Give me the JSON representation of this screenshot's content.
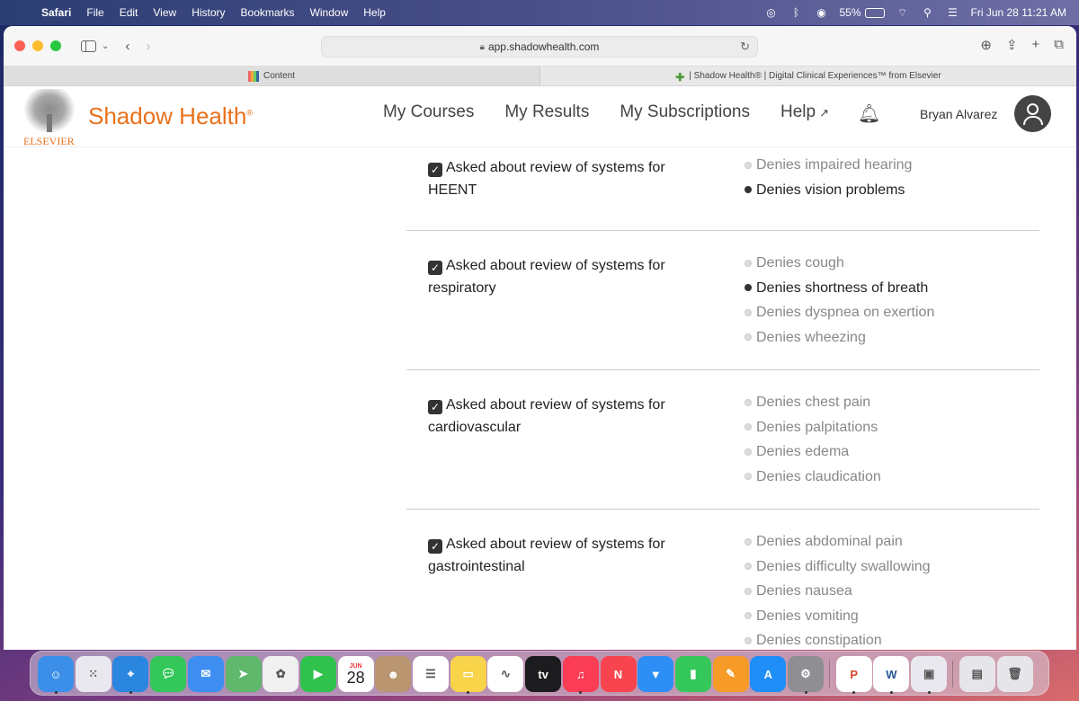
{
  "menubar": {
    "app": "Safari",
    "items": [
      "File",
      "Edit",
      "View",
      "History",
      "Bookmarks",
      "Window",
      "Help"
    ],
    "battery": "55%",
    "battery_level": 0.55,
    "datetime": "Fri Jun 28  11:21 AM"
  },
  "browser": {
    "url": "app.shadowhealth.com",
    "tabs": [
      {
        "label": "Content",
        "active": true
      },
      {
        "label": "| Shadow Health® | Digital Clinical Experiences™ from Elsevier",
        "active": false
      }
    ]
  },
  "site": {
    "publisher": "ELSEVIER",
    "brand": "Shadow Health",
    "brand_mark": "®",
    "nav": [
      "My Courses",
      "My Results",
      "My Subscriptions",
      "Help"
    ],
    "help_ext_icon": "external-link-icon",
    "user": "Bryan Alvarez",
    "colors": {
      "brand": "#e9711c",
      "text": "#444444"
    }
  },
  "review": [
    {
      "question": "Asked about review of systems for HEENT",
      "checked": true,
      "findings": [
        {
          "text": "Denies impaired hearing",
          "selected": false
        },
        {
          "text": "Denies vision problems",
          "selected": true
        }
      ]
    },
    {
      "question": "Asked about review of systems for respiratory",
      "checked": true,
      "findings": [
        {
          "text": "Denies cough",
          "selected": false
        },
        {
          "text": "Denies shortness of breath",
          "selected": true
        },
        {
          "text": "Denies dyspnea on exertion",
          "selected": false
        },
        {
          "text": "Denies wheezing",
          "selected": false
        }
      ]
    },
    {
      "question": "Asked about review of systems for cardiovascular",
      "checked": true,
      "findings": [
        {
          "text": "Denies chest pain",
          "selected": false
        },
        {
          "text": "Denies palpitations",
          "selected": false
        },
        {
          "text": "Denies edema",
          "selected": false
        },
        {
          "text": "Denies claudication",
          "selected": false
        }
      ]
    },
    {
      "question": "Asked about review of systems for gastrointestinal",
      "checked": true,
      "findings": [
        {
          "text": "Denies abdominal pain",
          "selected": false
        },
        {
          "text": "Denies difficulty swallowing",
          "selected": false
        },
        {
          "text": "Denies nausea",
          "selected": false
        },
        {
          "text": "Denies vomiting",
          "selected": false
        },
        {
          "text": "Denies constipation",
          "selected": false
        }
      ]
    }
  ],
  "dock": {
    "calendar_month": "JUN",
    "calendar_day": "28",
    "tv_label": "tv",
    "apps": [
      {
        "name": "finder-icon",
        "color": "#3b8fe8",
        "running": true
      },
      {
        "name": "launchpad-icon",
        "color": "#e8e8ee",
        "running": false
      },
      {
        "name": "safari-icon",
        "color": "#2b86e0",
        "running": true
      },
      {
        "name": "messages-icon",
        "color": "#34c759",
        "running": false
      },
      {
        "name": "mail-icon",
        "color": "#3d8ef0",
        "running": false
      },
      {
        "name": "maps-icon",
        "color": "#5fb86b",
        "running": false
      },
      {
        "name": "photos-icon",
        "color": "#f0f0f0",
        "running": false
      },
      {
        "name": "facetime-icon",
        "color": "#2fc24c",
        "running": false
      },
      {
        "name": "calendar-icon",
        "color": "#ffffff",
        "running": false
      },
      {
        "name": "contacts-icon",
        "color": "#b99570",
        "running": false
      },
      {
        "name": "reminders-icon",
        "color": "#ffffff",
        "running": false
      },
      {
        "name": "notes-icon",
        "color": "#f7d44a",
        "running": true
      },
      {
        "name": "freeform-icon",
        "color": "#ffffff",
        "running": false
      },
      {
        "name": "tv-icon",
        "color": "#1c1c1e",
        "running": false
      },
      {
        "name": "music-icon",
        "color": "#fa3c55",
        "running": true
      },
      {
        "name": "news-icon",
        "color": "#f7444e",
        "running": false
      },
      {
        "name": "keynote-icon",
        "color": "#2d8ef5",
        "running": false
      },
      {
        "name": "numbers-icon",
        "color": "#34c759",
        "running": false
      },
      {
        "name": "pages-icon",
        "color": "#f69b27",
        "running": false
      },
      {
        "name": "app-store-icon",
        "color": "#1f8ef7",
        "running": false
      },
      {
        "name": "system-settings-icon",
        "color": "#8e8e93",
        "running": true
      },
      {
        "name": "powerpoint-icon",
        "color": "#ffffff",
        "running": true
      },
      {
        "name": "word-icon",
        "color": "#ffffff",
        "running": true
      },
      {
        "name": "preview-icon",
        "color": "#e8e8ee",
        "running": true
      },
      {
        "name": "downloads-stack-icon",
        "color": "#e5e5ea",
        "running": false
      },
      {
        "name": "trash-icon",
        "color": "#e5e5ea",
        "running": false
      }
    ]
  }
}
